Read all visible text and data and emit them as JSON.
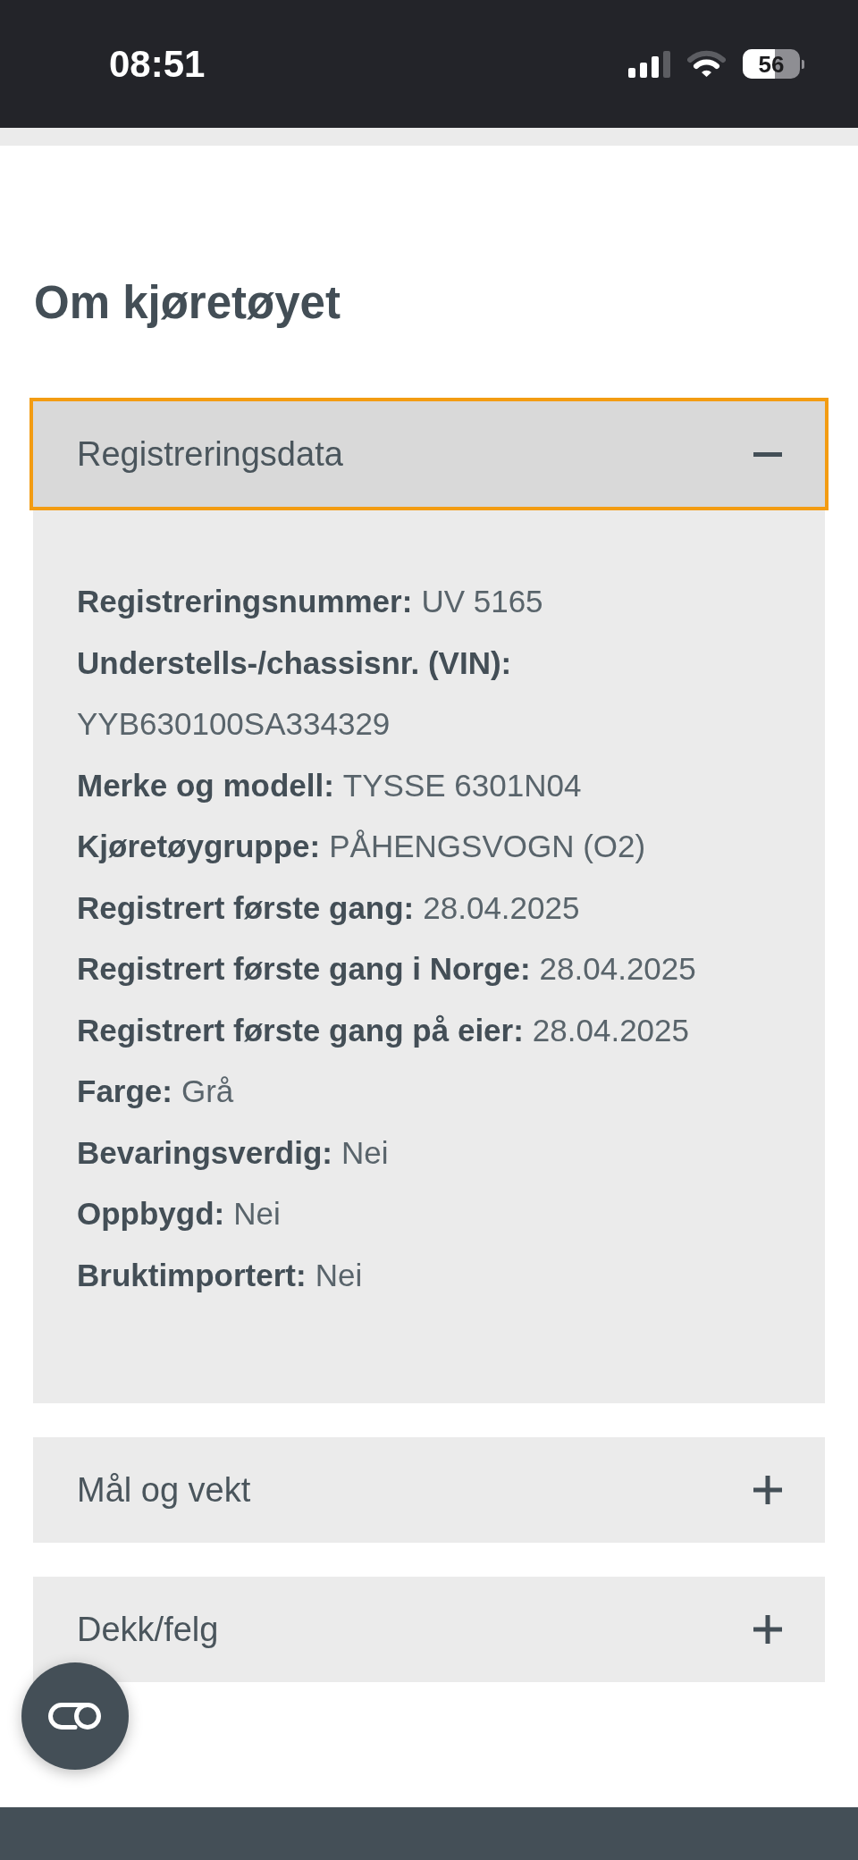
{
  "status_bar": {
    "time": "08:51",
    "battery": "56"
  },
  "heading": "Om kjøretøyet",
  "sections": [
    {
      "title": "Registreringsdata",
      "expanded": true,
      "focused": true,
      "fields": [
        {
          "label": "Registreringsnummer:",
          "value": "UV 5165"
        },
        {
          "label": "Understells-/chassisnr. (VIN):",
          "value": "YYB630100SA334329"
        },
        {
          "label": "Merke og modell:",
          "value": "TYSSE 6301N04"
        },
        {
          "label": "Kjøretøygruppe:",
          "value": "PÅHENGSVOGN (O2)"
        },
        {
          "label": "Registrert første gang:",
          "value": "28.04.2025"
        },
        {
          "label": "Registrert første gang i Norge:",
          "value": "28.04.2025"
        },
        {
          "label": "Registrert første gang på eier:",
          "value": "28.04.2025"
        },
        {
          "label": "Farge:",
          "value": "Grå"
        },
        {
          "label": "Bevaringsverdig:",
          "value": "Nei"
        },
        {
          "label": "Oppbygd:",
          "value": "Nei"
        },
        {
          "label": "Bruktimportert:",
          "value": "Nei"
        }
      ]
    },
    {
      "title": "Mål og vekt",
      "expanded": false,
      "focused": false
    },
    {
      "title": "Dekk/felg",
      "expanded": false,
      "focused": false
    }
  ]
}
